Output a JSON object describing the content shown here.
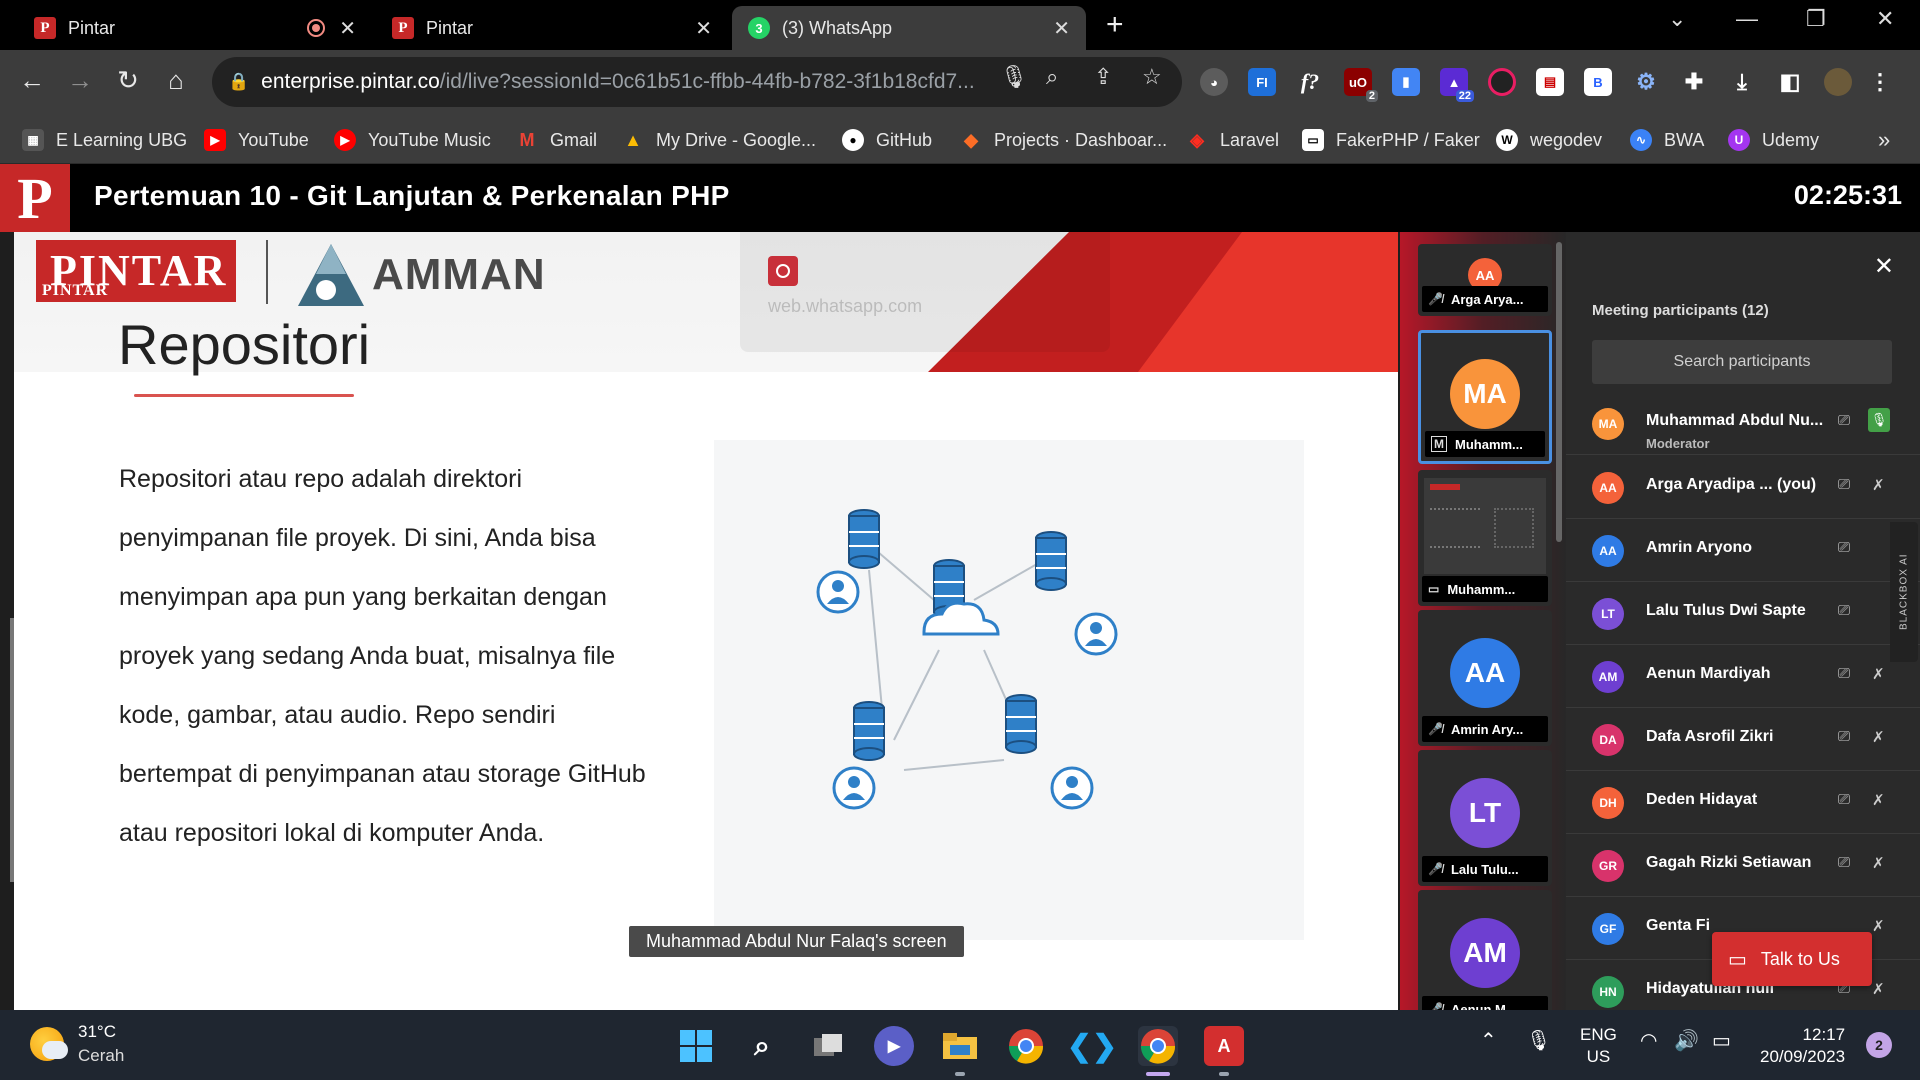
{
  "browser": {
    "tabs": [
      {
        "title": "Pintar",
        "recording": true
      },
      {
        "title": "Pintar"
      },
      {
        "title": "(3) WhatsApp",
        "badge": "3"
      }
    ],
    "url_host": "enterprise.pintar.co",
    "url_path": "/id/live?sessionId=0c61b51c-ffbb-44fb-b782-3f1b18cfd7...",
    "extension_badges": {
      "ublock": "2",
      "purple": "22"
    },
    "bookmarks": [
      {
        "label": "E Learning UBG",
        "icon": "elearning-icon",
        "color": "#555555"
      },
      {
        "label": "YouTube",
        "icon": "youtube-icon",
        "color": "#ff0000"
      },
      {
        "label": "YouTube Music",
        "icon": "youtube-music-icon",
        "color": "#ff0000"
      },
      {
        "label": "Gmail",
        "icon": "gmail-icon",
        "color": "#ea4335"
      },
      {
        "label": "My Drive - Google...",
        "icon": "google-drive-icon",
        "color": "#1fa463"
      },
      {
        "label": "GitHub",
        "icon": "github-icon",
        "color": "#ffffff"
      },
      {
        "label": "Projects · Dashboar...",
        "icon": "gitlab-icon",
        "color": "#fc6d26"
      },
      {
        "label": "Laravel",
        "icon": "laravel-icon",
        "color": "#ff2d20"
      },
      {
        "label": "FakerPHP / Faker",
        "icon": "faker-icon",
        "color": "#ffffff"
      },
      {
        "label": "wegodev",
        "icon": "wegodev-icon",
        "color": "#ffffff"
      },
      {
        "label": "BWA",
        "icon": "bwa-icon",
        "color": "#3b82f6"
      },
      {
        "label": "Udemy",
        "icon": "udemy-icon",
        "color": "#a435f0"
      }
    ],
    "bookmarks_more": "»"
  },
  "meeting": {
    "logo": "P",
    "title": "Pertemuan 10 - Git Lanjutan & Perkenalan PHP",
    "timer": "02:25:31"
  },
  "slide": {
    "brand_pintar": "PINTAR",
    "brand_pintar_small": "PINTAR",
    "brand_amman": "AMMAN",
    "title": "Repositori",
    "paragraph_lines": [
      "Repositori atau repo adalah direktori",
      "penyimpanan file proyek. Di sini, Anda bisa",
      "menyimpan apa pun yang berkaitan dengan",
      "proyek yang sedang Anda buat, misalnya file",
      "kode, gambar, atau audio. Repo sendiri",
      "bertempat di penyimpanan atau storage GitHub",
      "atau repositori lokal di komputer Anda."
    ],
    "ghost_text": "web.whatsapp.com",
    "screen_label": "Muhammad Abdul Nur Falaq's screen"
  },
  "tiles": [
    {
      "initials": "AA",
      "name": "Arga Arya...",
      "color": "#f4623a",
      "state": "muted"
    },
    {
      "initials": "MA",
      "name": "Muhamm...",
      "color": "#f9943b",
      "state": "moderator",
      "active": true
    },
    {
      "initials": "",
      "name": "Muhamm...",
      "color": "#2b2b2b",
      "state": "screen"
    },
    {
      "initials": "AA",
      "name": "Amrin Ary...",
      "color": "#2f7be5",
      "state": "muted"
    },
    {
      "initials": "LT",
      "name": "Lalu Tulu...",
      "color": "#7b4fd6",
      "state": "muted"
    },
    {
      "initials": "AM",
      "name": "Aenun M...",
      "color": "#6e3fd1",
      "state": "muted"
    }
  ],
  "panel": {
    "title": "Meeting participants (12)",
    "search_placeholder": "Search participants",
    "participants": [
      {
        "initials": "MA",
        "name": "Muhammad Abdul Nu...",
        "role": "Moderator",
        "color": "#f9943b",
        "mic_on": true
      },
      {
        "initials": "AA",
        "name": "Arga Aryadipa ...  (you)",
        "role": "",
        "color": "#f4623a",
        "mic_on": false
      },
      {
        "initials": "AA",
        "name": "Amrin Aryono",
        "role": "",
        "color": "#2f7be5",
        "mic_on": false
      },
      {
        "initials": "LT",
        "name": "Lalu Tulus Dwi Sapte",
        "role": "",
        "color": "#7b4fd6",
        "mic_on": false
      },
      {
        "initials": "AM",
        "name": "Aenun Mardiyah",
        "role": "",
        "color": "#6e3fd1",
        "mic_on": false
      },
      {
        "initials": "DA",
        "name": "Dafa Asrofil Zikri",
        "role": "",
        "color": "#d8336b",
        "mic_on": false
      },
      {
        "initials": "DH",
        "name": "Deden Hidayat",
        "role": "",
        "color": "#f4623a",
        "mic_on": false
      },
      {
        "initials": "GR",
        "name": "Gagah Rizki Setiawan",
        "role": "",
        "color": "#d8336b",
        "mic_on": false
      },
      {
        "initials": "GF",
        "name": "Genta Fi",
        "role": "",
        "color": "#2f7be5",
        "mic_on": false
      },
      {
        "initials": "HN",
        "name": "Hidayatullah null",
        "role": "",
        "color": "#2e9d5b",
        "mic_on": false
      }
    ],
    "blackbox_label": "BLACKBOX AI",
    "talk_label": "Talk to Us"
  },
  "taskbar": {
    "temp": "31°C",
    "condition": "Cerah",
    "lang_top": "ENG",
    "lang_bottom": "US",
    "time": "12:17",
    "date": "20/09/2023",
    "notifications": "2"
  }
}
